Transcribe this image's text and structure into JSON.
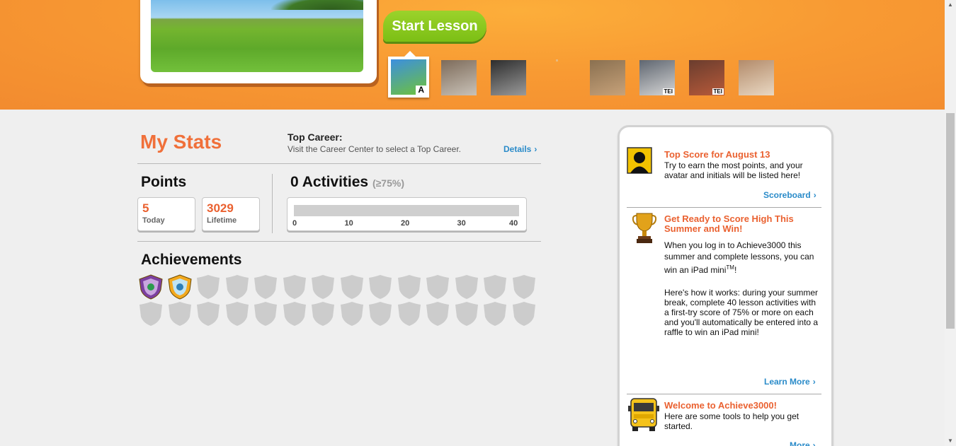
{
  "hero": {
    "start_label": "Start Lesson",
    "thumbnails": [
      {
        "name": "thumb-meadow",
        "level": "A",
        "tei": false,
        "colors": [
          "#3c8fe0",
          "#6ec23a"
        ],
        "selected": true
      },
      {
        "name": "thumb-football",
        "level": "",
        "tei": false,
        "colors": [
          "#7d6b5a",
          "#c9c2b8"
        ],
        "selected": false
      },
      {
        "name": "thumb-crowd",
        "level": "",
        "tei": false,
        "colors": [
          "#2d2d2d",
          "#9a9a9a"
        ],
        "selected": false
      },
      {
        "name": "thumb-plant",
        "level": "",
        "tei": false,
        "colors": [
          "#8a7050",
          "#c7a27a"
        ],
        "selected": false
      },
      {
        "name": "thumb-classroom",
        "level": "",
        "tei": true,
        "tei_label": "TEI",
        "colors": [
          "#5f6670",
          "#d6d6d6"
        ],
        "selected": false
      },
      {
        "name": "thumb-group",
        "level": "",
        "tei": true,
        "tei_label": "TEI",
        "colors": [
          "#6a3d2e",
          "#b85a3a"
        ],
        "selected": false
      },
      {
        "name": "thumb-bee",
        "level": "",
        "tei": false,
        "colors": [
          "#b38b6a",
          "#e9d8c3"
        ],
        "selected": false
      }
    ]
  },
  "stats": {
    "title": "My Stats",
    "top_career_label": "Top Career:",
    "top_career_desc": "Visit the Career Center to select a Top Career.",
    "details_label": "Details",
    "points_heading": "Points",
    "today_value": "5",
    "today_label": "Today",
    "lifetime_value": "3029",
    "lifetime_label": "Lifetime",
    "activities_heading": "0 Activities",
    "activities_extra": "(≥75%)",
    "activities_progress": 0,
    "activities_ticks": [
      "0",
      "10",
      "20",
      "30",
      "40"
    ],
    "achievements_heading": "Achievements",
    "achievements_earned": 2,
    "achievements_total": 28
  },
  "sidebar": {
    "item1_title": "Top Score for August 13",
    "item1_text": "Try to earn the most points, and your avatar and initials will be listed here!",
    "item1_link": "Scoreboard",
    "item2_title": "Get Ready to Score High This Summer and Win!",
    "item2_text1": "When you log in to Achieve3000 this summer and complete lessons, you can win an iPad mini",
    "item2_tm": "TM",
    "item2_excl": "!",
    "item2_text2": "Here's how it works: during your summer break, complete 40 lesson activities with a first-try score of 75% or more on each and you'll automatically be entered into a raffle to win an iPad mini!",
    "item2_link": "Learn More",
    "item3_title": "Welcome to Achieve3000!",
    "item3_text": "Here are some tools to help you get started.",
    "item3_link": "More"
  },
  "colors": {
    "accent": "#ea6130",
    "link": "#2a8bc9",
    "green": "#7cbf15",
    "orange": "#f89a33"
  }
}
